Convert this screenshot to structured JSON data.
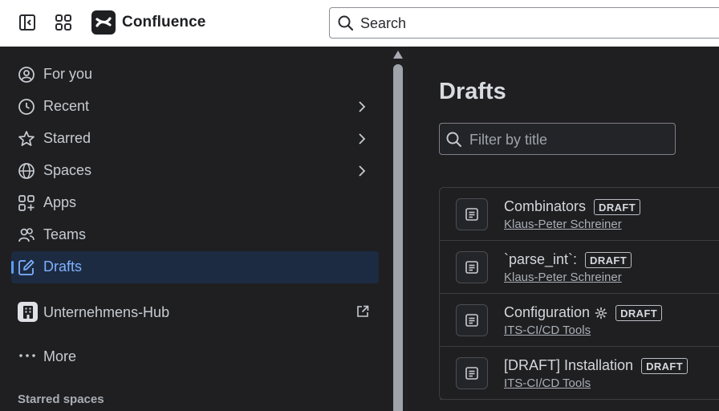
{
  "app": {
    "name": "Confluence",
    "search_placeholder": "Search"
  },
  "sidebar": {
    "items": [
      {
        "label": "For you",
        "icon": "person-circle-icon",
        "chevron": false
      },
      {
        "label": "Recent",
        "icon": "clock-icon",
        "chevron": true
      },
      {
        "label": "Starred",
        "icon": "star-icon",
        "chevron": true
      },
      {
        "label": "Spaces",
        "icon": "globe-icon",
        "chevron": true
      },
      {
        "label": "Apps",
        "icon": "apps-grid-plus-icon",
        "chevron": false
      },
      {
        "label": "Teams",
        "icon": "people-icon",
        "chevron": false
      },
      {
        "label": "Drafts",
        "icon": "edit-icon",
        "chevron": false,
        "active": true
      }
    ],
    "hub": {
      "label": "Unternehmens-Hub",
      "icon": "building-icon",
      "action_icon": "external-link-icon"
    },
    "more_label": "More",
    "starred_spaces_title": "Starred spaces"
  },
  "main": {
    "title": "Drafts",
    "filter_placeholder": "Filter by title",
    "drafts": [
      {
        "title": "Combinators",
        "badge": "DRAFT",
        "author": "Klaus-Peter Schreiner",
        "gear": false
      },
      {
        "title": "`parse_int`:",
        "badge": "DRAFT",
        "author": "Klaus-Peter Schreiner",
        "gear": false
      },
      {
        "title": "Configuration",
        "badge": "DRAFT",
        "author": "ITS-CI/CD Tools",
        "gear": true
      },
      {
        "title": "[DRAFT] Installation",
        "badge": "DRAFT",
        "author": "ITS-CI/CD Tools",
        "gear": false
      }
    ]
  },
  "colors": {
    "background": "#1f1f21",
    "active_bg": "#1c2b42",
    "active_text": "#7fb0ff",
    "topbar": "#ffffff"
  }
}
